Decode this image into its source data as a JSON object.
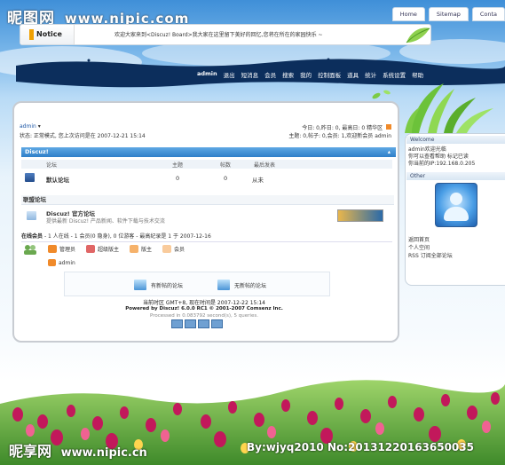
{
  "watermark": {
    "site": "昵图网",
    "url": "www.nipic.com",
    "bottom_site": "昵享网",
    "bottom_url": "www.nipic.cn",
    "id_text": "By:wjyq2010 No:20131220163650035"
  },
  "topnav": [
    "Home",
    "Sitemap",
    "Conta"
  ],
  "notice": {
    "label": "Notice",
    "text": "欢迎大家来到<Discuz! Board>我大家在这里留下美好的回忆,您将在所在的家园快乐 ~"
  },
  "nav": {
    "items": [
      "admin",
      "退出",
      "短消息",
      "会员",
      "搜索",
      "我的",
      "控制面板",
      "道具",
      "统计",
      "系统设置",
      "帮助"
    ]
  },
  "user": {
    "name": "admin",
    "status": "状态: 正常模式, 您上次访问是在  2007-12-21 15:14"
  },
  "stats_top": {
    "line1": "今日: 0,昨日: 0, 最高日: 0  精华区",
    "line2": "主题: 0,帖子: 0,会员: 1,欢迎新会员 admin"
  },
  "section_main": {
    "title": "Discuz!",
    "cols": [
      "论坛",
      "主题",
      "帖数",
      "最后发表"
    ],
    "forum": {
      "name": "默认论坛",
      "topics": "0",
      "posts": "0",
      "last": "从未"
    }
  },
  "section_links": {
    "title": "联盟论坛",
    "name": "Discuz! 官方论坛",
    "desc": "提供最新  Discuz! 产品新闻、软件下载与技术交流"
  },
  "online": {
    "title": "在线会员",
    "text": "- 1 人在线 - 1 会员(0 隐身), 0 位游客 - 最高纪录是  1 于  2007-12-16"
  },
  "legend": [
    "管理员",
    "超级版主",
    "版主",
    "会员"
  ],
  "online_user": "admin",
  "post_stats": {
    "new": "有新帖的论坛",
    "none": "无新帖的论坛"
  },
  "footer": {
    "time": "当前时区  GMT+8, 现在时间是  2007-12-22 15:14",
    "powered": "Powered by Discuz! 6.0.0 RC1  © 2001-2007 Comsenz Inc.",
    "processed": "Processed in 0.083792 second(s), 5 queries."
  },
  "sidebar": {
    "welcome_title": "Welcome",
    "welcome_user": "admin欢迎光临",
    "links1": "你可以查看帮助  标记已读",
    "ip": "你当前的IP:192.168.0.205",
    "other_title": "Other",
    "links": [
      "返回首页",
      "个人空间",
      "RSS 订阅全部论坛"
    ]
  },
  "colors": {
    "navband": "#0c2e5c",
    "section": "#2f7fc8",
    "link": "#1a55a5"
  }
}
